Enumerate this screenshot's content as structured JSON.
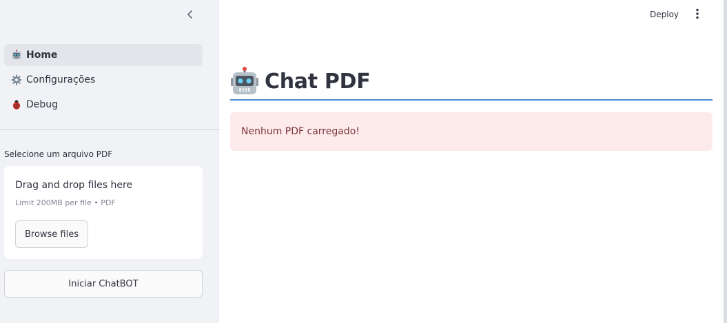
{
  "sidebar": {
    "nav_items": [
      {
        "label": "Home",
        "icon": "robot-icon",
        "active": true
      },
      {
        "label": "Configurações",
        "icon": "gear-icon",
        "active": false
      },
      {
        "label": "Debug",
        "icon": "ladybug-icon",
        "active": false
      }
    ],
    "uploader": {
      "label": "Selecione um arquivo PDF",
      "title": "Drag and drop files here",
      "hint": "Limit 200MB per file • PDF",
      "browse_label": "Browse files"
    },
    "start_button_label": "Iniciar ChatBOT"
  },
  "header": {
    "deploy_label": "Deploy"
  },
  "main": {
    "title": "Chat PDF",
    "alert_text": "Nenhum PDF carregado!"
  },
  "colors": {
    "sidebar_bg": "#f0f2f6",
    "accent_rule": "#4a90d6",
    "alert_bg": "#fdeaea",
    "alert_text": "#7d353b"
  }
}
